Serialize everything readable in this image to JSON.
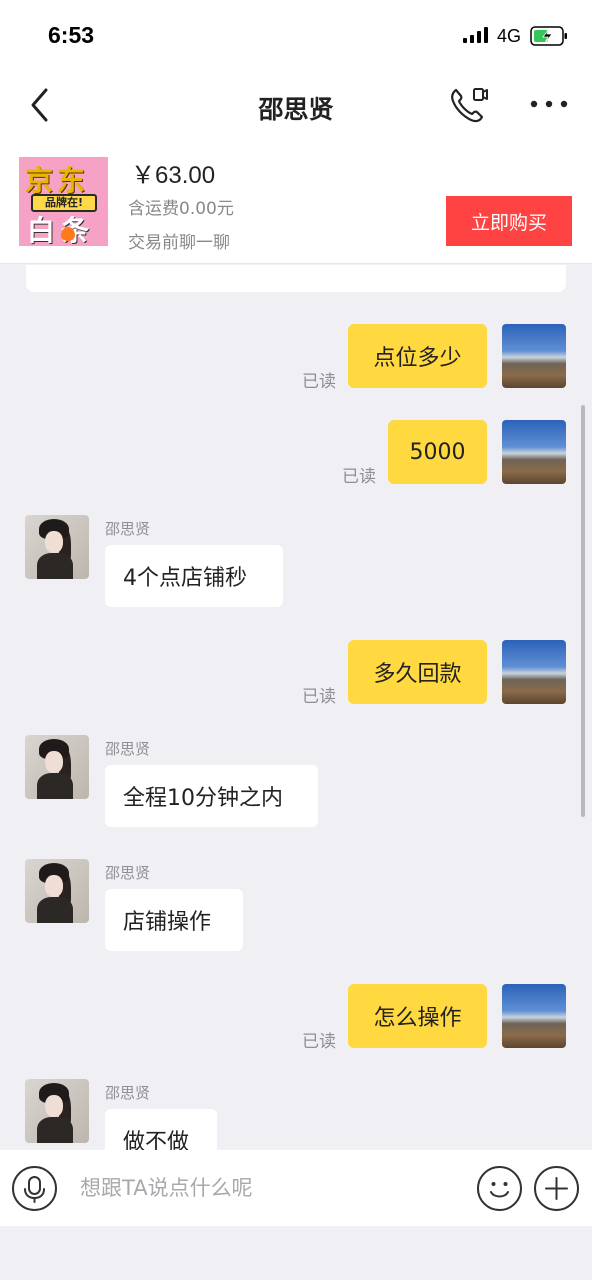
{
  "status_bar": {
    "time": "6:53",
    "network": "4G",
    "icons": [
      "signal-icon",
      "battery-charging-icon"
    ]
  },
  "nav": {
    "title": "邵思贤",
    "icons": [
      "back-arrow-icon",
      "video-call-icon",
      "more-dots-icon"
    ]
  },
  "product": {
    "thumbnail_text_top": "京东",
    "thumbnail_badge": "品牌在!",
    "thumbnail_text_bottom": "白条",
    "price": "￥63.00",
    "shipping": "含运费0.00元",
    "hint": "交易前聊一聊",
    "buy_label": "立即购买",
    "buy_color": "#ff4343"
  },
  "chat": {
    "bubble_self_color": "#ffd93f",
    "read_label": "已读",
    "messages": [
      {
        "from": "self",
        "text": "点位多少",
        "status": "已读"
      },
      {
        "from": "self",
        "text": "5000",
        "status": "已读"
      },
      {
        "from": "other",
        "sender": "邵思贤",
        "text": "4个点店铺秒"
      },
      {
        "from": "self",
        "text": "多久回款",
        "status": "已读"
      },
      {
        "from": "other",
        "sender": "邵思贤",
        "text": "全程10分钟之内"
      },
      {
        "from": "other",
        "sender": "邵思贤",
        "text": "店铺操作"
      },
      {
        "from": "self",
        "text": "怎么操作",
        "status": "已读"
      },
      {
        "from": "other",
        "sender": "邵思贤",
        "text": "做不做"
      }
    ]
  },
  "input_bar": {
    "placeholder": "想跟TA说点什么呢",
    "icons": [
      "microphone-icon",
      "emoji-icon",
      "plus-icon"
    ]
  }
}
